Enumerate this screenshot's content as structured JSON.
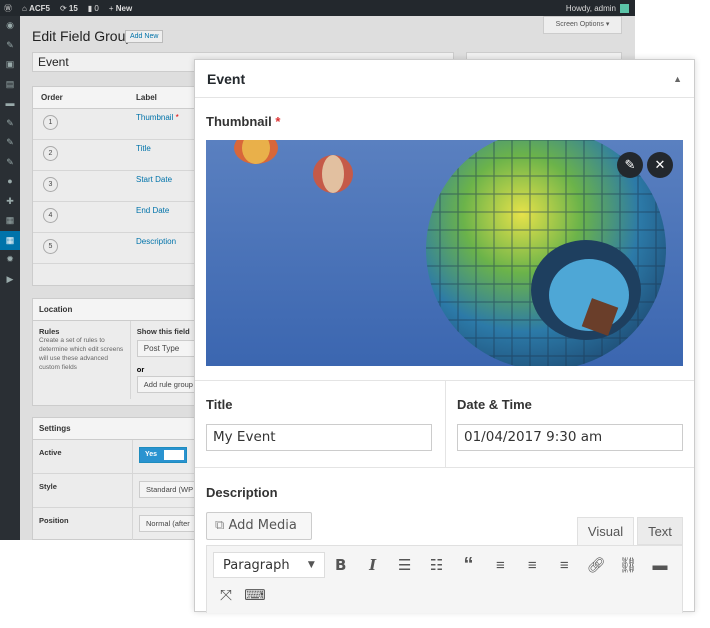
{
  "adminbar": {
    "site": "ACF5",
    "updates": "15",
    "comments": "0",
    "new": "New",
    "greeting": "Howdy, admin"
  },
  "screen_options": "Screen Options ▾",
  "page": {
    "title": "Edit Field Group",
    "add_new": "Add New",
    "group_title": "Event"
  },
  "fields_table": {
    "headers": [
      "Order",
      "Label"
    ],
    "rows": [
      {
        "order": "1",
        "label": "Thumbnail",
        "required": "*"
      },
      {
        "order": "2",
        "label": "Title",
        "required": ""
      },
      {
        "order": "3",
        "label": "Start Date",
        "required": ""
      },
      {
        "order": "4",
        "label": "End Date",
        "required": ""
      },
      {
        "order": "5",
        "label": "Description",
        "required": ""
      }
    ]
  },
  "location": {
    "heading": "Location",
    "rules_label": "Rules",
    "rules_help": "Create a set of rules to determine which edit screens will use these advanced custom fields",
    "show_if": "Show this field",
    "param": "Post Type",
    "or": "or",
    "add_group": "Add rule group"
  },
  "settings": {
    "heading": "Settings",
    "active_label": "Active",
    "active_value": "Yes",
    "style_label": "Style",
    "style_value": "Standard (WP",
    "position_label": "Position",
    "position_value": "Normal (after"
  },
  "panel": {
    "title": "Event",
    "thumbnail_label": "Thumbnail",
    "required_mark": "*",
    "title_label": "Title",
    "title_value": "My Event",
    "date_label": "Date & Time",
    "date_value": "01/04/2017 9:30 am",
    "description_label": "Description",
    "add_media": "Add Media",
    "tabs": [
      "Visual",
      "Text"
    ],
    "format": "Paragraph",
    "toolbar": [
      "bold",
      "italic",
      "bullet-list",
      "numbered-list",
      "blockquote",
      "align-left",
      "align-center",
      "align-right",
      "link",
      "unlink",
      "read-more",
      "fullscreen",
      "keyboard"
    ]
  }
}
